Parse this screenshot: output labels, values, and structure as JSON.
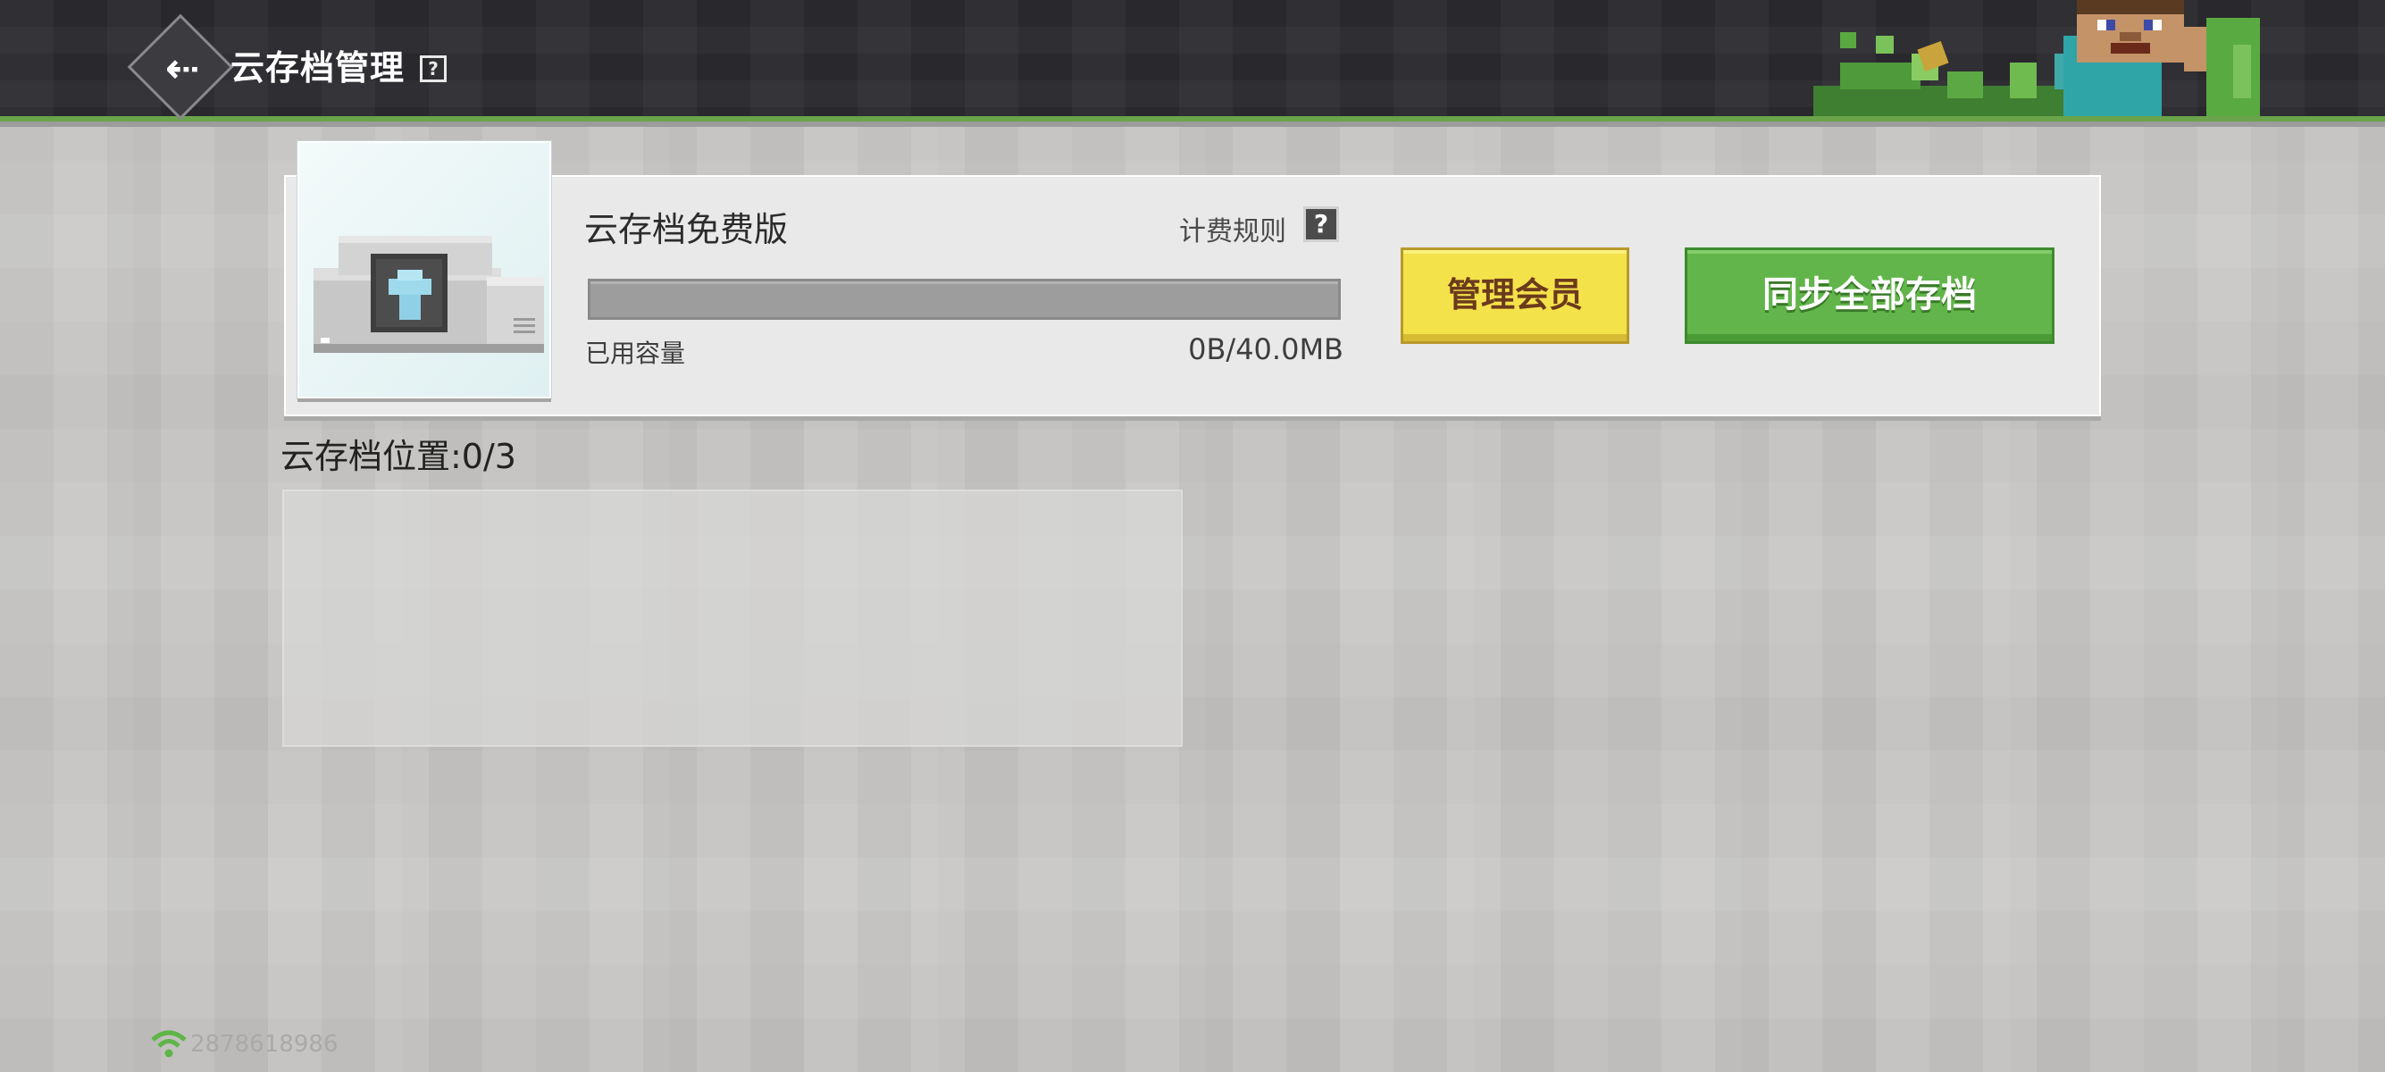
{
  "header": {
    "title": "云存档管理",
    "back_icon": "back-arrow-icon",
    "help_icon": "question-icon"
  },
  "plan": {
    "name": "云存档免费版",
    "billing_rules_label": "计费规则",
    "billing_help_icon": "question-icon",
    "used_label": "已用容量",
    "used_value": "0B/40.0MB",
    "used_fraction": 0
  },
  "buttons": {
    "manage_member": "管理会员",
    "sync_all": "同步全部存档"
  },
  "slots": {
    "label": "云存档位置:0/3"
  },
  "footer": {
    "network_icon": "wifi-icon",
    "user_id": "2878618986"
  },
  "colors": {
    "accent_green": "#62b54a",
    "member_yellow": "#f4e24a",
    "topbar": "#2e2e33"
  }
}
